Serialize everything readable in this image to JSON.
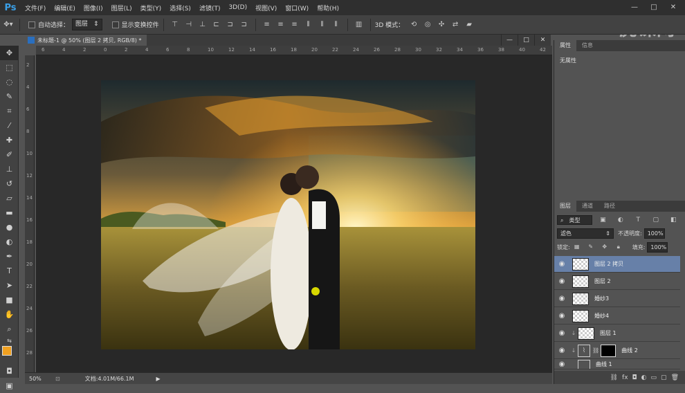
{
  "app": {
    "logo": "Ps"
  },
  "menu": [
    "文件(F)",
    "编辑(E)",
    "图像(I)",
    "图层(L)",
    "类型(Y)",
    "选择(S)",
    "滤镜(T)",
    "3D(D)",
    "视图(V)",
    "窗口(W)",
    "帮助(H)"
  ],
  "window_controls": [
    "—",
    "□",
    "✕"
  ],
  "options": {
    "auto_select_label": "自动选择：",
    "auto_select_value": "图层",
    "show_transform_label": "显示变换控件",
    "mode_3d_label": "3D 模式："
  },
  "watermark": "虎课网",
  "document": {
    "tab_label": "未标题-1 @ 50% (图层 2 拷贝, RGB/8) *",
    "controls": [
      "—",
      "□",
      "✕"
    ]
  },
  "ruler_h": [
    "6",
    "4",
    "2",
    "0",
    "2",
    "4",
    "6",
    "8",
    "10",
    "12",
    "14",
    "16",
    "18",
    "20",
    "22",
    "24",
    "26",
    "28",
    "30",
    "32",
    "34",
    "36",
    "38",
    "40",
    "42"
  ],
  "ruler_v": [
    "2",
    "4",
    "6",
    "8",
    "10",
    "12",
    "14",
    "16",
    "18",
    "20",
    "22",
    "24",
    "26",
    "28"
  ],
  "status": {
    "zoom": "50%",
    "doc": "文档:4.01M/66.1M"
  },
  "props_panel": {
    "tabs": [
      "属性",
      "信息"
    ],
    "content": "无属性"
  },
  "layers_panel": {
    "tabs": [
      "图层",
      "通道",
      "路径"
    ],
    "filter_label": "类型",
    "blend_mode": "滤色",
    "opacity_label": "不透明度:",
    "opacity_value": "100%",
    "lock_label": "锁定:",
    "fill_label": "填充:",
    "fill_value": "100%",
    "layers": [
      {
        "name": "图层 2 拷贝",
        "selected": true
      },
      {
        "name": "图层 2",
        "selected": false
      },
      {
        "name": "婚纱3",
        "selected": false
      },
      {
        "name": "婚纱4",
        "selected": false
      },
      {
        "name": "图层 1",
        "selected": false
      },
      {
        "name": "曲线 2",
        "selected": false
      },
      {
        "name": "曲线 1",
        "selected": false
      }
    ]
  },
  "colors": {
    "foreground": "#f0a020",
    "background": "#000000",
    "selection": "#6780a8",
    "accent": "#3aa0e8"
  }
}
